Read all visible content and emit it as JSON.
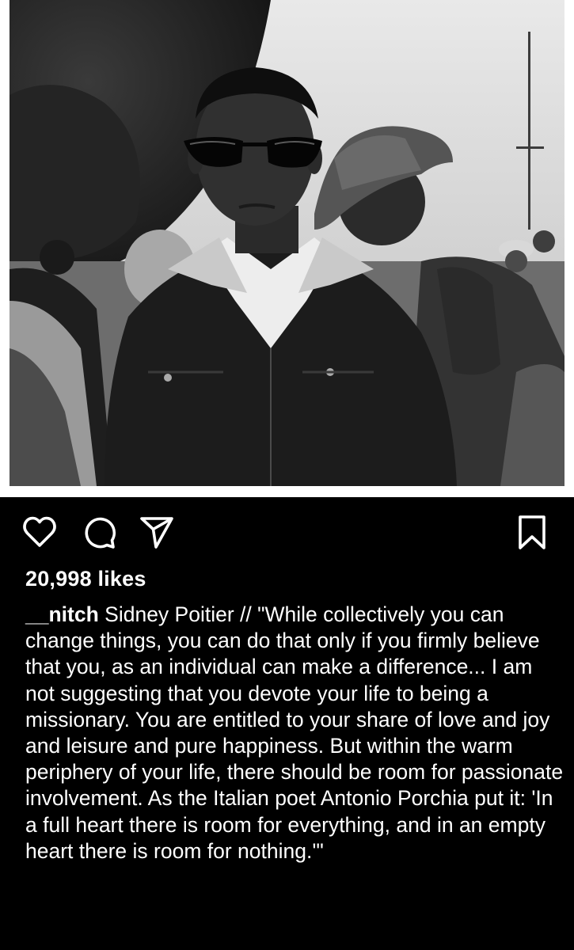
{
  "post": {
    "photo": {
      "alt": "Sidney Poitier in sunglasses and a work jacket, walking in a crowd"
    },
    "likes_text": "20,998 likes",
    "caption": {
      "username": "__nitch",
      "text": "Sidney Poitier // \"While collectively you can change things, you can do that only if you firmly believe that you, as an individual can make a difference... I am not suggesting that you devote your life to being a missionary. You are entitled to your share of love and joy and leisure and pure happiness. But within the warm periphery of your life, there should be room for passionate involvement. As the Italian poet Antonio Porchia put it: 'In a full heart there is room for everything, and in an empty heart there is room for nothing.'\""
    },
    "icons": {
      "like": "heart-icon",
      "comment": "comment-bubble-icon",
      "share": "paper-plane-icon",
      "save": "bookmark-icon"
    }
  }
}
